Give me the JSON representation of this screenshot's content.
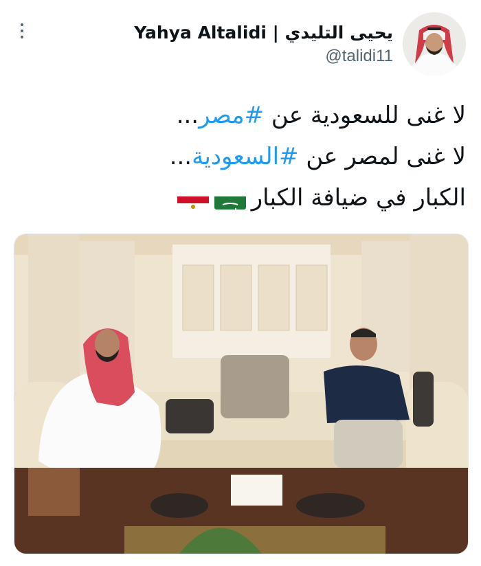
{
  "tweet": {
    "display_name": "Yahya Altalidi | يحيى التليدي",
    "handle": "@talidi11",
    "line1_prefix": "لا غنى للسعودية عن ",
    "line1_hashtag": "#مصر",
    "line1_suffix": "...",
    "line2_prefix": "لا غنى لمصر عن ",
    "line2_hashtag": "#السعودية",
    "line2_suffix": "...",
    "line3_text": "الكبار في ضيافة الكبار",
    "flags": [
      "saudi-flag",
      "egypt-flag"
    ]
  },
  "icons": {
    "more": "more-vertical-icon"
  },
  "colors": {
    "hashtag": "#1d9bf0",
    "secondary_text": "#536471",
    "primary_text": "#0f1419"
  }
}
